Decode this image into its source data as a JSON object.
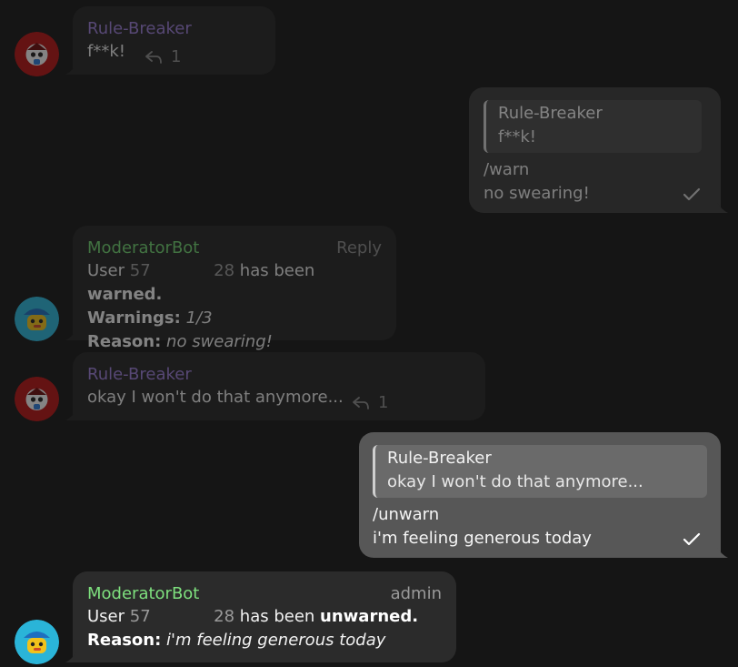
{
  "messages": [
    {
      "id": "m1",
      "sender": "Rule-Breaker",
      "text": "f**k!",
      "reply_count": "1"
    },
    {
      "id": "m2",
      "quote": {
        "sender": "Rule-Breaker",
        "text": "f**k!"
      },
      "lines": [
        "/warn",
        "no swearing!"
      ]
    },
    {
      "id": "m3",
      "sender": "ModeratorBot",
      "right_label": "Reply",
      "user_prefix": "User",
      "user_a": "57",
      "user_b": "28",
      "has_been": "has been",
      "status": "warned.",
      "warnings_label": "Warnings:",
      "warnings_value": "1/3",
      "reason_label": "Reason:",
      "reason_value": "no swearing!"
    },
    {
      "id": "m4",
      "sender": "Rule-Breaker",
      "text": "okay I won't do that anymore...",
      "reply_count": "1"
    },
    {
      "id": "m5",
      "quote": {
        "sender": "Rule-Breaker",
        "text": "okay I won't do that anymore..."
      },
      "lines": [
        "/unwarn",
        "i'm feeling generous today"
      ]
    },
    {
      "id": "m6",
      "sender": "ModeratorBot",
      "right_label": "admin",
      "user_prefix": "User",
      "user_a": "57",
      "user_b": "28",
      "has_been": "has been",
      "status": "unwarned.",
      "reason_label": "Reason:",
      "reason_value": "i'm feeling generous today"
    }
  ],
  "icons": {
    "reply": "reply-arrow-icon",
    "check": "read-check-icon"
  }
}
